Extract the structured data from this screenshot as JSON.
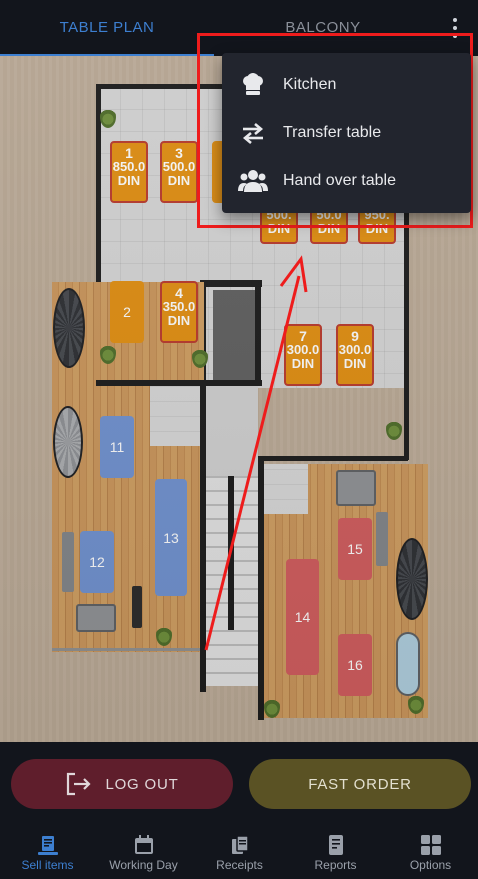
{
  "top_tabs": [
    {
      "label": "TABLE PLAN",
      "active": true
    },
    {
      "label": "BALCONY",
      "active": false
    }
  ],
  "menu": {
    "items": [
      {
        "label": "Kitchen",
        "icon": "chef-hat-icon"
      },
      {
        "label": "Transfer table",
        "icon": "transfer-arrows-icon"
      },
      {
        "label": "Hand over table",
        "icon": "people-icon"
      }
    ]
  },
  "tables": {
    "t1": {
      "number": "1",
      "amount": "850.0",
      "currency": "DIN"
    },
    "t3": {
      "number": "3",
      "amount": "500.0",
      "currency": "DIN"
    },
    "t2": {
      "number": "2"
    },
    "t4": {
      "number": "4",
      "amount": "350.0",
      "currency": "DIN"
    },
    "t5": {
      "amount": "500.",
      "currency": "DIN"
    },
    "t6": {
      "amount": "50.0",
      "currency": "DIN"
    },
    "t8": {
      "amount": "950.",
      "currency": "DIN"
    },
    "t7": {
      "number": "7",
      "amount": "300.0",
      "currency": "DIN"
    },
    "t9": {
      "number": "9",
      "amount": "300.0",
      "currency": "DIN"
    },
    "t11": {
      "number": "11"
    },
    "t12": {
      "number": "12"
    },
    "t13": {
      "number": "13"
    },
    "t14": {
      "number": "14"
    },
    "t15": {
      "number": "15"
    },
    "t16": {
      "number": "16"
    }
  },
  "actions": {
    "logout_label": "LOG OUT",
    "fast_order_label": "FAST ORDER"
  },
  "nav": [
    {
      "label": "Sell items",
      "icon": "sell-items-icon",
      "active": true
    },
    {
      "label": "Working Day",
      "icon": "calendar-icon",
      "active": false
    },
    {
      "label": "Receipts",
      "icon": "receipts-icon",
      "active": false
    },
    {
      "label": "Reports",
      "icon": "reports-icon",
      "active": false
    },
    {
      "label": "Options",
      "icon": "grid-icon",
      "active": false
    }
  ],
  "colors": {
    "accent": "#3d7fd0",
    "annotation": "#ee1c1c",
    "logout_button": "#5f1e2c",
    "fast_order_button": "#5a5224",
    "occupied_table": "#d98a12",
    "blue_table": "#6d8dc8",
    "red_table": "#c95a5b"
  }
}
